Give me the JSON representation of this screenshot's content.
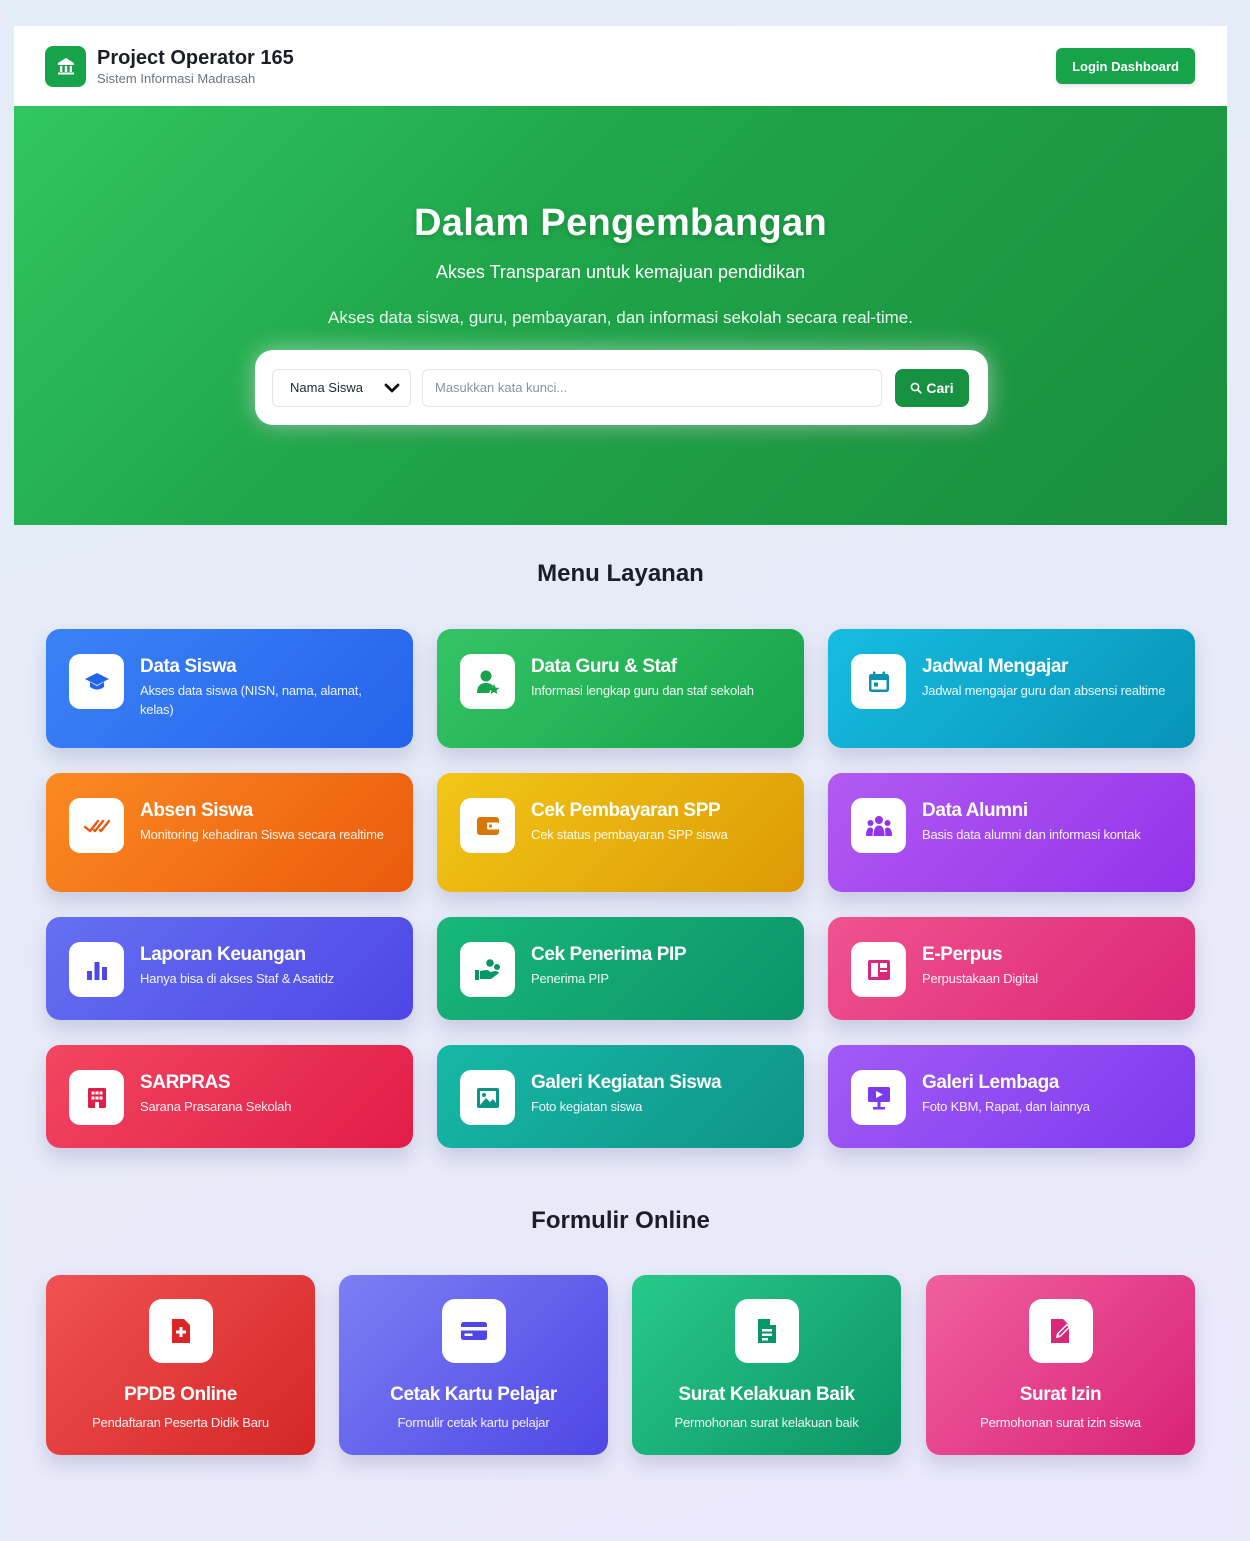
{
  "header": {
    "title": "Project Operator 165",
    "subtitle": "Sistem Informasi Madrasah",
    "login_label": "Login Dashboard"
  },
  "hero": {
    "title": "Dalam Pengembangan",
    "tagline": "Akses Transparan untuk kemajuan pendidikan",
    "description": "Akses data siswa, guru, pembayaran, dan informasi sekolah secara real-time."
  },
  "search": {
    "selected_option": "Nama Siswa",
    "placeholder": "Masukkan kata kunci...",
    "button_label": "Cari"
  },
  "menu": {
    "title": "Menu Layanan",
    "items": [
      {
        "title": "Data Siswa",
        "desc": "Akses data siswa (NISN, nama, alamat, kelas)",
        "icon": "graduation-cap-icon",
        "color": "#2563eb"
      },
      {
        "title": "Data Guru & Staf",
        "desc": "Informasi lengkap guru dan staf sekolah",
        "icon": "user-star-icon",
        "color": "#16a34a"
      },
      {
        "title": "Jadwal Mengajar",
        "desc": "Jadwal mengajar guru dan absensi realtime",
        "icon": "calendar-icon",
        "color": "#0891b2"
      },
      {
        "title": "Absen Siswa",
        "desc": "Monitoring kehadiran Siswa secara realtime",
        "icon": "check-double-icon",
        "color": "#ea580c"
      },
      {
        "title": "Cek Pembayaran SPP",
        "desc": "Cek status pembayaran SPP siswa",
        "icon": "wallet-icon",
        "color": "#d97706"
      },
      {
        "title": "Data Alumni",
        "desc": "Basis data alumni dan informasi kontak",
        "icon": "users-icon",
        "color": "#9333ea"
      },
      {
        "title": "Laporan Keuangan",
        "desc": "Hanya bisa di akses Staf & Asatidz",
        "icon": "bar-chart-icon",
        "color": "#4f46e5"
      },
      {
        "title": "Cek Penerima PIP",
        "desc": "Penerima PIP",
        "icon": "hand-coins-icon",
        "color": "#059669"
      },
      {
        "title": "E-Perpus",
        "desc": "Perpustakaan Digital",
        "icon": "book-icon",
        "color": "#db2777"
      },
      {
        "title": "SARPRAS",
        "desc": "Sarana Prasarana Sekolah",
        "icon": "building-icon",
        "color": "#e11d48"
      },
      {
        "title": "Galeri Kegiatan Siswa",
        "desc": "Foto kegiatan siswa",
        "icon": "image-icon",
        "color": "#0d9488"
      },
      {
        "title": "Galeri Lembaga",
        "desc": "Foto KBM, Rapat, dan lainnya",
        "icon": "presentation-icon",
        "color": "#7c3aed"
      }
    ]
  },
  "forms": {
    "title": "Formulir Online",
    "items": [
      {
        "title": "PPDB Online",
        "desc": "Pendaftaran Peserta Didik Baru",
        "icon": "file-plus-icon",
        "color": "#dc2626"
      },
      {
        "title": "Cetak Kartu Pelajar",
        "desc": "Formulir cetak kartu pelajar",
        "icon": "id-card-icon",
        "color": "#4f46e5"
      },
      {
        "title": "Surat Kelakuan Baik",
        "desc": "Permohonan surat kelakuan baik",
        "icon": "file-text-icon",
        "color": "#059669"
      },
      {
        "title": "Surat Izin",
        "desc": "Permohonan surat izin siswa",
        "icon": "edit-file-icon",
        "color": "#db2777"
      }
    ]
  },
  "colors": {
    "brand_green": "#16a34a",
    "hero_green": "#1fa64a"
  }
}
